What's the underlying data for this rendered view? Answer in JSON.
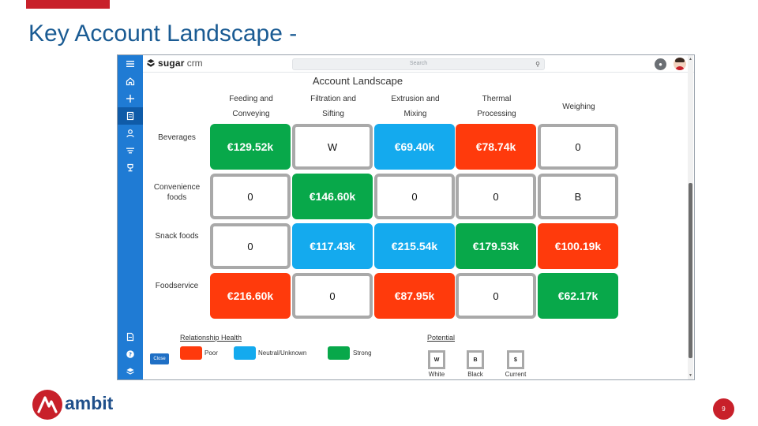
{
  "slide": {
    "title": "Key Account Landscape -",
    "page_number": "9",
    "brand": "ambit"
  },
  "crm": {
    "logo_sugar": "sugar",
    "logo_crm": "crm",
    "search_placeholder": "Search",
    "close_label": "Close",
    "sidebar_icons": [
      "menu-icon",
      "home-icon",
      "plus-icon",
      "accounts-icon",
      "contacts-icon",
      "filter-icon",
      "trophy-icon",
      "document-icon",
      "help-icon",
      "layers-icon"
    ]
  },
  "landscape": {
    "title": "Account Landscape",
    "columns": [
      "Feeding and\nConveying",
      "Filtration and\nSifting",
      "Extrusion and\nMixing",
      "Thermal\nProcessing",
      "Weighing"
    ],
    "rows": [
      {
        "label": "Beverages",
        "cells": [
          {
            "value": "€129.52k",
            "status": "strong"
          },
          {
            "value": "W",
            "status": "empty"
          },
          {
            "value": "€69.40k",
            "status": "neutral"
          },
          {
            "value": "€78.74k",
            "status": "poor"
          },
          {
            "value": "0",
            "status": "empty"
          }
        ]
      },
      {
        "label": "Convenience\nfoods",
        "cells": [
          {
            "value": "0",
            "status": "empty"
          },
          {
            "value": "€146.60k",
            "status": "strong"
          },
          {
            "value": "0",
            "status": "empty"
          },
          {
            "value": "0",
            "status": "empty"
          },
          {
            "value": "B",
            "status": "empty"
          }
        ]
      },
      {
        "label": "Snack foods",
        "cells": [
          {
            "value": "0",
            "status": "empty"
          },
          {
            "value": "€117.43k",
            "status": "neutral"
          },
          {
            "value": "€215.54k",
            "status": "neutral"
          },
          {
            "value": "€179.53k",
            "status": "strong"
          },
          {
            "value": "€100.19k",
            "status": "poor"
          }
        ]
      },
      {
        "label": "Foodservice",
        "cells": [
          {
            "value": "€216.60k",
            "status": "poor"
          },
          {
            "value": "0",
            "status": "empty"
          },
          {
            "value": "€87.95k",
            "status": "poor"
          },
          {
            "value": "0",
            "status": "empty"
          },
          {
            "value": "€62.17k",
            "status": "strong"
          }
        ]
      }
    ]
  },
  "legend": {
    "health_title": "Relationship Health",
    "health": [
      {
        "label": "Poor",
        "color": "#ff3a0c"
      },
      {
        "label": "Neutral/Unknown",
        "color": "#14aaee"
      },
      {
        "label": "Strong",
        "color": "#08a84a"
      }
    ],
    "potential_title": "Potential",
    "potential": [
      {
        "symbol": "W",
        "label": "White"
      },
      {
        "symbol": "B",
        "label": "Black"
      },
      {
        "symbol": "$",
        "label": "Current"
      }
    ]
  },
  "colors": {
    "accent": "#c8202a",
    "title_blue": "#1a5b93",
    "sidebar_blue": "#1f7bd4",
    "strong": "#08a84a",
    "neutral": "#14aaee",
    "poor": "#ff3a0c",
    "empty_border": "#a9a9a9"
  }
}
